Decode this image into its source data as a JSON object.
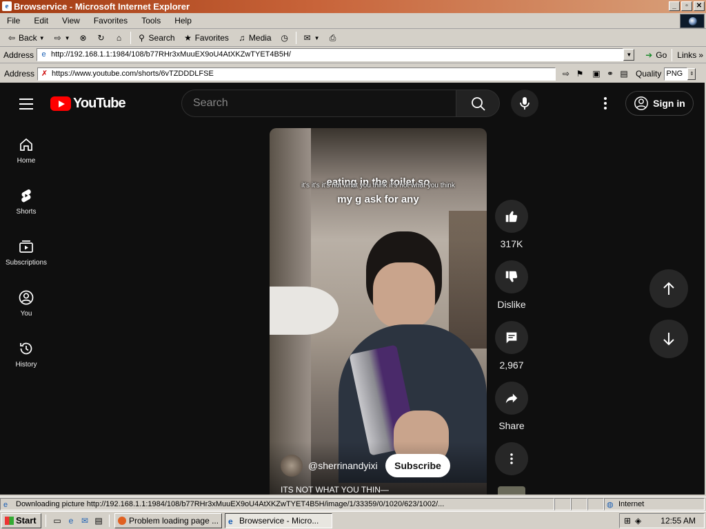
{
  "window": {
    "title": "Browservice - Microsoft Internet Explorer",
    "minimize": "_",
    "maximize": "▫",
    "close": "✕"
  },
  "menu": [
    "File",
    "Edit",
    "View",
    "Favorites",
    "Tools",
    "Help"
  ],
  "toolbar": {
    "back": "Back",
    "search": "Search",
    "favorites": "Favorites",
    "media": "Media"
  },
  "address_bar": {
    "label": "Address",
    "url": "http://192.168.1.1:1984/108/b77RHr3xMuuEX9oU4AtXKZwTYET4B5H/",
    "go": "Go",
    "links": "Links"
  },
  "inner_bar": {
    "label": "Address",
    "url": "https://www.youtube.com/shorts/6vTZDDDLFSE",
    "quality_label": "Quality",
    "quality_value": "PNG"
  },
  "youtube": {
    "logo_text": "YouTube",
    "search_placeholder": "Search",
    "sign_in": "Sign in",
    "nav": [
      {
        "label": "Home",
        "icon": "home-icon"
      },
      {
        "label": "Shorts",
        "icon": "shorts-icon"
      },
      {
        "label": "Subscriptions",
        "icon": "subscriptions-icon"
      },
      {
        "label": "You",
        "icon": "account-icon"
      },
      {
        "label": "History",
        "icon": "history-icon"
      }
    ],
    "video": {
      "caption_main_1": "eating in the toilet so",
      "caption_overlay": "it's it's it's not what you think it's not what you think",
      "caption_main_2": "my g      ask for any",
      "channel": "@sherrinandyixi",
      "subscribe": "Subscribe",
      "title": "ITS NOT WHAT YOU THIN—"
    },
    "actions": {
      "likes": "317K",
      "dislike": "Dislike",
      "comments": "2,967",
      "share": "Share"
    }
  },
  "status": {
    "text": "Downloading picture http://192.168.1.1:1984/108/b77RHr3xMuuEX9oU4AtXKZwTYET4B5H/image/1/33359/0/1020/623/1002/...",
    "zone": "Internet"
  },
  "taskbar": {
    "start": "Start",
    "tasks": [
      "Problem loading page ...",
      "Browservice - Micro..."
    ],
    "clock": "12:55 AM"
  },
  "colors": {
    "yt_bg": "#0f0f0f",
    "yt_red": "#ff0000",
    "ie_title": "#a23b12"
  }
}
